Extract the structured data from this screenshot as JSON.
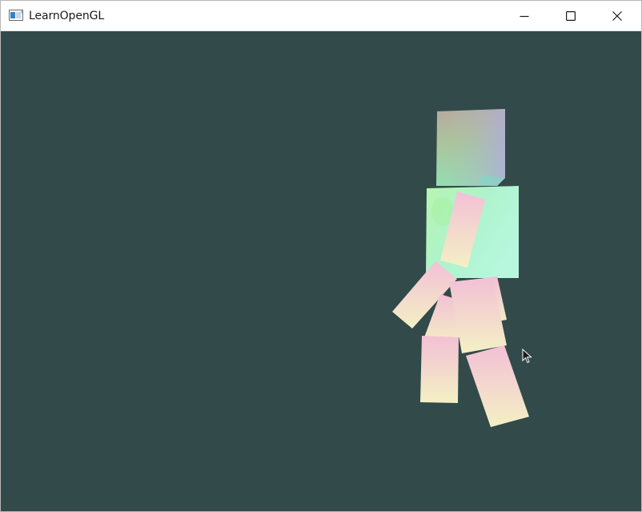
{
  "window": {
    "title": "LearnOpenGL",
    "app_icon": "window-app-icon",
    "controls": [
      "minimize-icon",
      "maximize-icon",
      "close-icon"
    ]
  },
  "scene": {
    "clear_color": "#324a4a",
    "description_parts": [
      "head",
      "torso",
      "left-arm",
      "right-arm",
      "left-leg",
      "right-leg"
    ]
  },
  "colors": {
    "titlebar_bg": "#ffffff",
    "title_text": "#1a1a1a"
  }
}
